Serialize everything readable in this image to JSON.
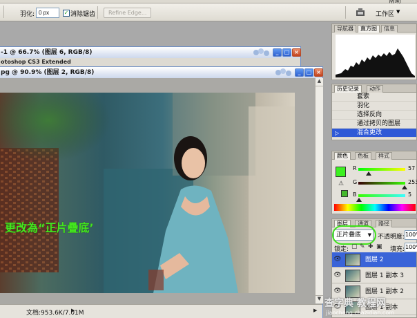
{
  "menu": {
    "items": [
      "帮助"
    ]
  },
  "options_bar": {
    "feather_label": "羽化:",
    "feather_value": "0 px",
    "antialias_label": "消除锯齿",
    "antialias_checked": true,
    "refine_edge_label": "Refine Edge...",
    "workspace_label": "工作区"
  },
  "documents": [
    {
      "title": "-1 @ 66.7% (图层 6, RGB/8)",
      "subtitle": "otoshop CS3 Extended"
    },
    {
      "title": "pg @ 90.9% (图层 2, RGB/8)",
      "annotation": "更改為“正片疊底’",
      "status": "文档:953.6K/7.01M"
    }
  ],
  "navigator_panel": {
    "tabs": [
      "导航器",
      "直方图",
      "信息"
    ],
    "active_tab": 1
  },
  "history_panel": {
    "tabs": [
      "历史记录",
      "动作"
    ],
    "items": [
      "套索",
      "羽化",
      "选择反向",
      "通过拷贝的图层",
      "混合更改"
    ],
    "selected_index": 4
  },
  "color_panel": {
    "tabs": [
      "颜色",
      "色板",
      "样式"
    ],
    "foreground": "#3cf020",
    "channels": [
      {
        "label": "R",
        "value": "57",
        "fraction": 0.22
      },
      {
        "label": "G",
        "value": "253",
        "fraction": 0.99
      },
      {
        "label": "B",
        "value": "5",
        "fraction": 0.02
      }
    ]
  },
  "layers_panel": {
    "tabs": [
      "图层",
      "通道",
      "路径"
    ],
    "blend_mode": "正片疊底",
    "opacity_label": "不透明度:",
    "opacity_value": "100%",
    "lock_label": "锁定:",
    "fill_label": "填充:",
    "fill_value": "100%",
    "layers": [
      "图层 2",
      "图层 1 副本 3",
      "图层 1 副本 2",
      "图层 1 副本"
    ],
    "selected_index": 0
  },
  "watermark": {
    "text": "查字典 教程网",
    "url": "jiaocheng.chazidian.com"
  }
}
